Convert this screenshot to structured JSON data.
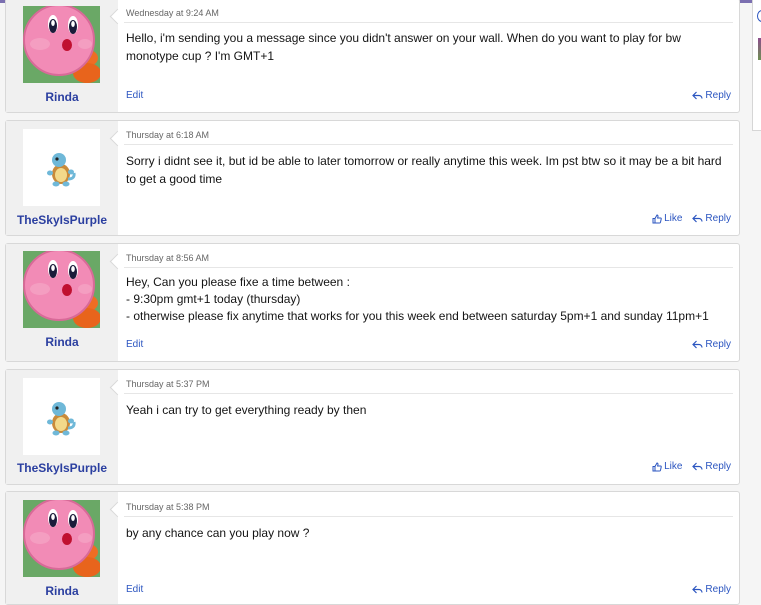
{
  "posts": [
    {
      "user": "Rinda",
      "avatar": "kirby-avatar",
      "time": "Wednesday at 9:24 AM",
      "lines": [
        "Hello, i'm sending you a message since you didn't answer on your wall. When do you want to play for bw",
        "monotype cup ? I'm GMT+1"
      ],
      "edit": "Edit",
      "like": null,
      "reply": "Reply"
    },
    {
      "user": "TheSkyIsPurple",
      "avatar": "squirtle-avatar",
      "time": "Thursday at 6:18 AM",
      "lines": [
        "Sorry i didnt see it, but id be able to later tomorrow or really anytime this week. Im pst btw so it may be a bit hard",
        "to get a good time"
      ],
      "edit": null,
      "like": "Like",
      "reply": "Reply"
    },
    {
      "user": "Rinda",
      "avatar": "kirby-avatar",
      "time": "Thursday at 8:56 AM",
      "lines": [
        "Hey, Can you please fixe a time between :",
        "- 9:30pm gmt+1 today (thursday)",
        "- otherwise please fix anytime that works for you this week end between saturday 5pm+1 and sunday 11pm+1"
      ],
      "edit": "Edit",
      "like": null,
      "reply": "Reply"
    },
    {
      "user": "TheSkyIsPurple",
      "avatar": "squirtle-avatar",
      "time": "Thursday at 5:37 PM",
      "lines": [
        "Yeah i can try to get everything ready by then"
      ],
      "edit": null,
      "like": "Like",
      "reply": "Reply"
    },
    {
      "user": "Rinda",
      "avatar": "kirby-avatar",
      "time": "Thursday at 5:38 PM",
      "lines": [
        "by any chance can you play now ?"
      ],
      "edit": "Edit",
      "like": null,
      "reply": "Reply"
    }
  ],
  "colors": {
    "link": "#2b55c0",
    "username": "#2b3fa0",
    "top_accent": "#7b6fb0"
  }
}
